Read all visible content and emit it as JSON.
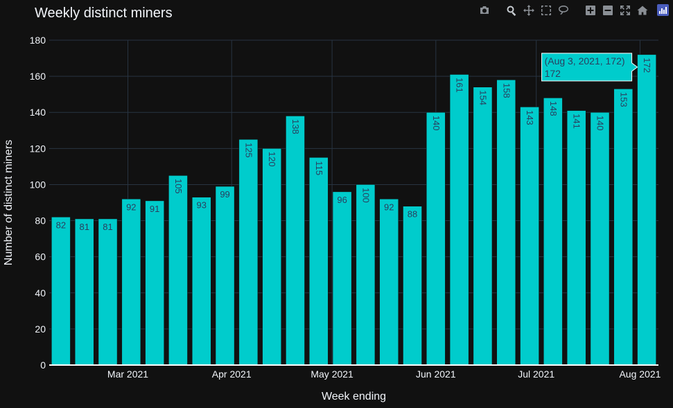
{
  "chart_data": {
    "type": "bar",
    "title": "Weekly distinct miners",
    "xlabel": "Week ending",
    "ylabel": "Number of distinct miners",
    "ylim": [
      0,
      180
    ],
    "yticks": [
      0,
      20,
      40,
      60,
      80,
      100,
      120,
      140,
      160,
      180
    ],
    "x_tick_labels": [
      "Mar 2021",
      "Apr 2021",
      "May 2021",
      "Jun 2021",
      "Jul 2021",
      "Aug 2021"
    ],
    "x_tick_dates": [
      "2021-03-01",
      "2021-04-01",
      "2021-05-01",
      "2021-06-01",
      "2021-07-01",
      "2021-08-01"
    ],
    "categories": [
      "2021-02-09",
      "2021-02-16",
      "2021-02-23",
      "2021-03-02",
      "2021-03-09",
      "2021-03-16",
      "2021-03-23",
      "2021-03-30",
      "2021-04-06",
      "2021-04-13",
      "2021-04-20",
      "2021-04-27",
      "2021-05-04",
      "2021-05-11",
      "2021-05-18",
      "2021-05-25",
      "2021-06-01",
      "2021-06-08",
      "2021-06-15",
      "2021-06-22",
      "2021-06-29",
      "2021-07-06",
      "2021-07-13",
      "2021-07-20",
      "2021-07-27",
      "2021-08-03"
    ],
    "values": [
      82,
      81,
      81,
      92,
      91,
      105,
      93,
      99,
      125,
      120,
      138,
      115,
      96,
      100,
      92,
      88,
      140,
      161,
      154,
      158,
      143,
      148,
      141,
      140,
      153,
      172
    ],
    "bar_color": "#00cccc",
    "grid": true,
    "hover_tooltip": {
      "line1": "(Aug 3, 2021, 172)",
      "line2": "172",
      "index": 25
    }
  },
  "toolbar": {
    "icons": [
      "camera-icon",
      "zoom-icon",
      "pan-icon",
      "box-select-icon",
      "lasso-select-icon",
      "zoom-in-icon",
      "zoom-out-icon",
      "autoscale-icon",
      "reset-axes-icon",
      "plotly-logo-icon"
    ]
  },
  "colors": {
    "background": "#111111",
    "grid": "#283442",
    "text": "#f2f5fa",
    "bar": "#00cccc",
    "bar_label": "#2a3f5f"
  }
}
